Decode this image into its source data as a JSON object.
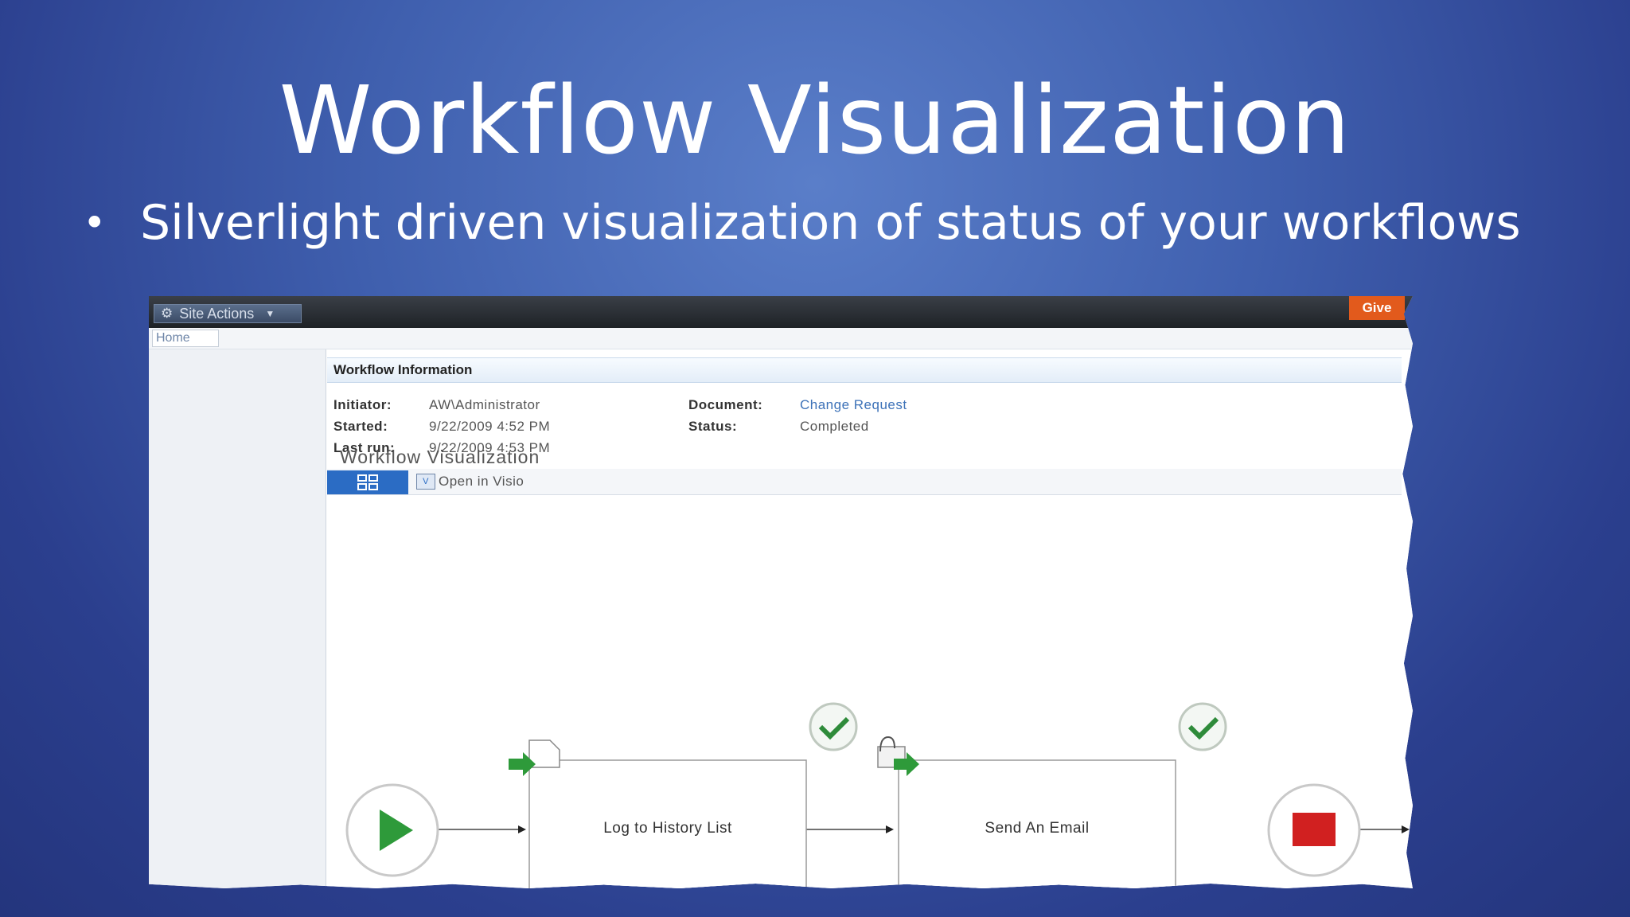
{
  "slide": {
    "title": "Workflow Visualization",
    "bullet": "Silverlight driven visualization of status of your workflows"
  },
  "sharepoint": {
    "site_actions": "Site Actions",
    "give_button": "Give",
    "home_tab": "Home",
    "workflow_info_header": "Workflow Information",
    "info": {
      "initiator_label": "Initiator:",
      "initiator_value": "AW\\Administrator",
      "started_label": "Started:",
      "started_value": "9/22/2009 4:52 PM",
      "last_run_label": "Last run:",
      "last_run_value": "9/22/2009 4:53 PM",
      "document_label": "Document:",
      "document_value": "Change Request",
      "status_label": "Status:",
      "status_value": "Completed"
    },
    "viz_title": "Workflow Visualization",
    "open_in_visio": "Open in Visio",
    "flow": {
      "step1_label": "Log to History List",
      "step2_label": "Send An Email",
      "step1_status": "completed",
      "step2_status": "completed"
    }
  },
  "icons": {
    "gear": "gear-icon",
    "play": "start-icon",
    "stop": "stop-icon",
    "check": "checkmark-icon"
  },
  "colors": {
    "start_green": "#2e9a3a",
    "stop_red": "#d12020",
    "check_green": "#2e8b3a",
    "link_blue": "#3d72b8"
  }
}
